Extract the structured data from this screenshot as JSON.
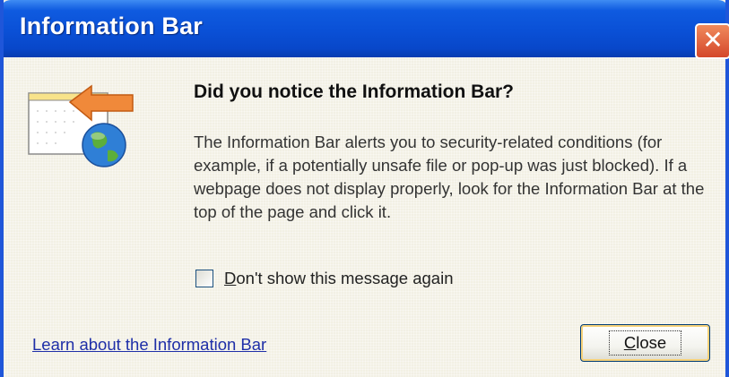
{
  "window": {
    "title": "Information Bar",
    "close_glyph": "✕"
  },
  "content": {
    "heading": "Did you notice the Information Bar?",
    "body": "The Information Bar alerts you to security-related conditions (for example, if a potentially unsafe file or pop-up was just blocked). If a webpage does not display properly, look for the Information Bar at the top of the page and click it.",
    "icon": "information-bar-globe-icon"
  },
  "checkbox": {
    "label_accel": "D",
    "label_rest": "on't show this message again",
    "checked": false
  },
  "footer": {
    "link_text": "Learn about the Information Bar",
    "close_button_accel": "C",
    "close_button_rest": "lose"
  },
  "colors": {
    "title_bar": "#0a50d6",
    "dialog_bg": "#f2f0e4",
    "close_x": "#d4472a",
    "link": "#1f2fa8"
  }
}
